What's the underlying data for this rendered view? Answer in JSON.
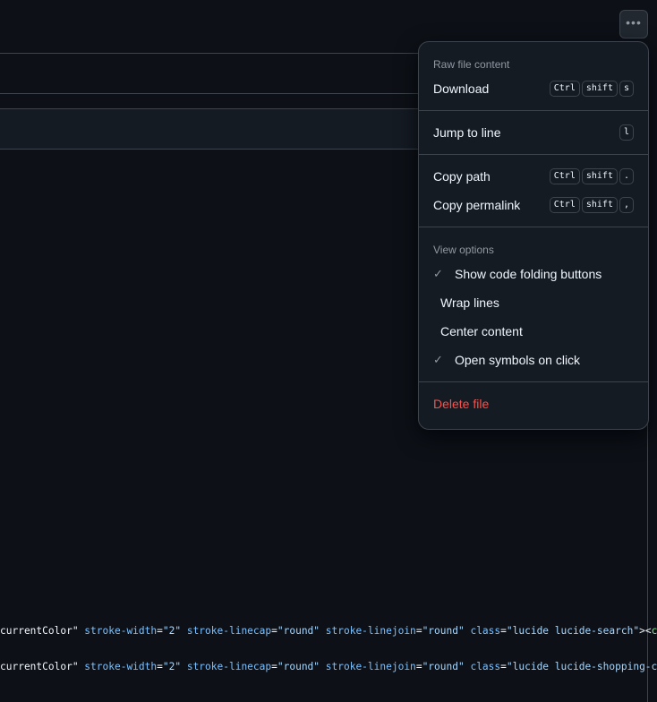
{
  "more_button": {
    "icon": "kebab-horizontal-icon"
  },
  "menu": {
    "raw_group": "Raw file content",
    "download": {
      "label": "Download",
      "keys": [
        "Ctrl",
        "shift",
        "s"
      ]
    },
    "jump": {
      "label": "Jump to line",
      "keys": [
        "l"
      ]
    },
    "copy_path": {
      "label": "Copy path",
      "keys": [
        "Ctrl",
        "shift",
        "."
      ]
    },
    "copy_permalink": {
      "label": "Copy permalink",
      "keys": [
        "Ctrl",
        "shift",
        ","
      ]
    },
    "view_group": "View options",
    "view_options": [
      {
        "label": "Show code folding buttons",
        "checked": true
      },
      {
        "label": "Wrap lines",
        "checked": false
      },
      {
        "label": "Center content",
        "checked": false
      },
      {
        "label": "Open symbols on click",
        "checked": true
      }
    ],
    "delete": "Delete file",
    "check_glyph": "✓"
  },
  "code_lines": [
    {
      "p1": "currentColor\" ",
      "a1": "stroke-width",
      "e1": "=",
      "s1": "\"2\" ",
      "a2": "stroke-linecap",
      "s2": "\"round\" ",
      "a3": "stroke-linejoin",
      "s3": "\"round\" ",
      "a4": "class",
      "s4": "\"lucide lucide-search\"",
      "end": "><",
      "tag": "ci"
    },
    {
      "p1": "currentColor\" ",
      "a1": "stroke-width",
      "e1": "=",
      "s1": "\"2\" ",
      "a2": "stroke-linecap",
      "s2": "\"round\" ",
      "a3": "stroke-linejoin",
      "s3": "\"round\" ",
      "a4": "class",
      "s4": "\"lucide lucide-shopping-ca",
      "end": "",
      "tag": ""
    }
  ],
  "colors": {
    "bg": "#0d1117",
    "overlay": "#151b23",
    "border": "#3d444d",
    "danger": "#f85149",
    "attr": "#79c0ff",
    "string": "#a5d6ff",
    "tag": "#7ee787"
  }
}
